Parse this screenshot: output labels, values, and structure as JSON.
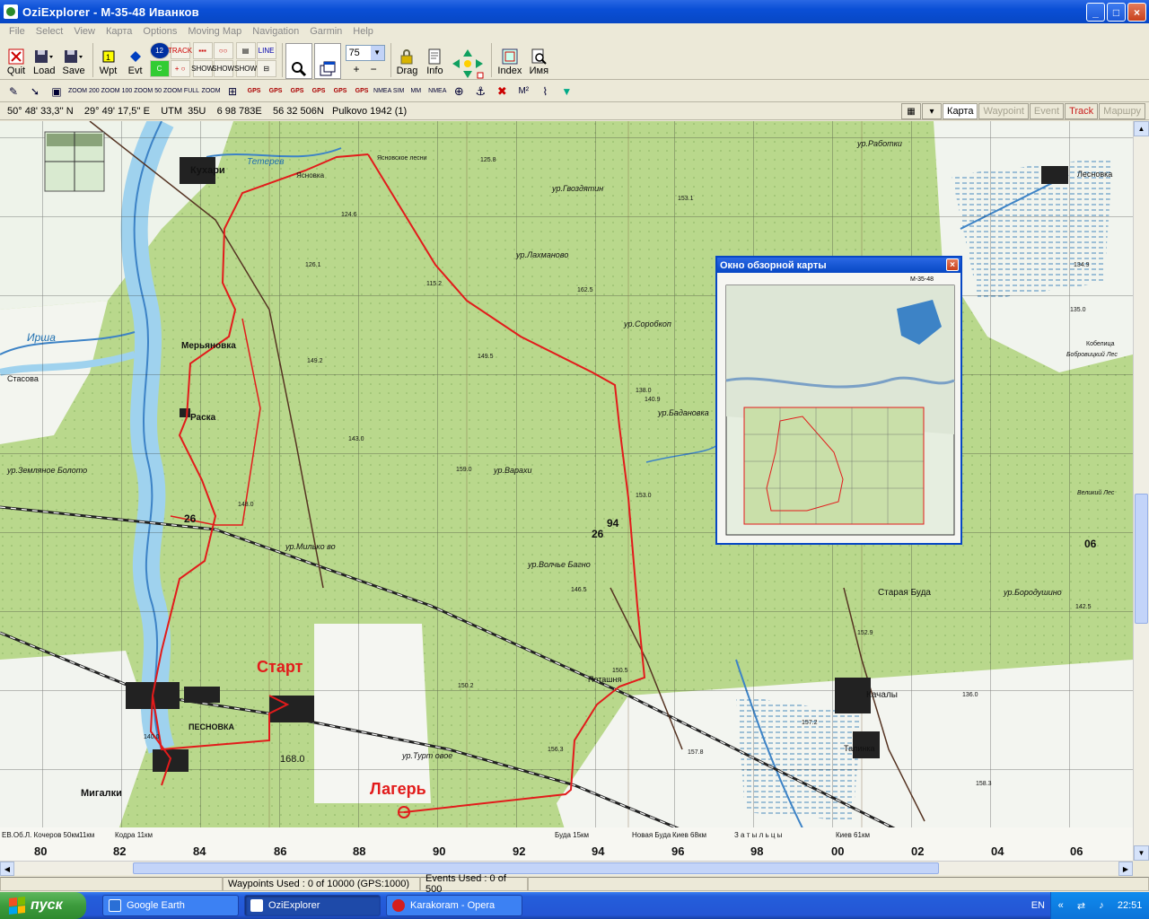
{
  "window": {
    "title": "OziExplorer - M-35-48 Иванков",
    "buttons": {
      "minimize": "_",
      "maximize": "□",
      "close": "×"
    }
  },
  "menu": [
    "File",
    "Select",
    "View",
    "Карта",
    "Options",
    "Moving Map",
    "Navigation",
    "Garmin",
    "Help"
  ],
  "toolbar1": {
    "quit": "Quit",
    "load": "Load",
    "save": "Save",
    "wpt": "Wpt",
    "evt": "Evt",
    "track_small": "TRACK",
    "show": "SHOW",
    "line": "LINE",
    "zoom_value": "75",
    "zoom_plus": "+",
    "zoom_minus": "−",
    "drag": "Drag",
    "info": "Info",
    "index": "Index",
    "name": "Имя"
  },
  "toolbar2": {
    "zoom200": "ZOOM 200",
    "zoom100": "ZOOM 100",
    "zoom50": "ZOOM 50",
    "zoomfull": "ZOOM FULL",
    "zoom": "ZOOM",
    "gps": [
      "GPS",
      "GPS",
      "GPS",
      "GPS",
      "GPS",
      "GPS"
    ],
    "nmea_sim": "NMEA SIM",
    "mm": "MM",
    "nmea": "NMEA"
  },
  "status": {
    "coords": "50° 48' 33,3'' N    29° 49' 17,5'' E    UTM  35U    6 98 783E    56 32 506N   Pulkovo 1942 (1)",
    "tabs": [
      "Карта",
      "Waypoint",
      "Event",
      "Track",
      "Маршру"
    ]
  },
  "map": {
    "labels": {
      "start": "Старт",
      "camp": "Лагерь",
      "kukhari": "Кухари",
      "teterev": "Тетерев",
      "yasnovka": "Ясновка",
      "yasnovskoe": "Ясновское лесни",
      "gvozdyatin": "ур.Гвоздятин",
      "lakhmanovo": "ур.Лахманово",
      "sorobkop": "ур.Соробкоп",
      "rabotki": "ур.Работки",
      "lesnovka": "Лесновка",
      "irsha": "Ирша",
      "meryanovka": "Мерьяновка",
      "raska": "Раска",
      "stasova": "Стасова",
      "zemlyanoe": "ур.Земляное Болото",
      "varakhi": "ур.Варахи",
      "milkovo": "ур.Милько во",
      "volche": "ур.Волчье Багно",
      "badanovo": "ур.Бадановка",
      "staraya_buda": "Старая Буда",
      "borodushino": "ур.Бородушино",
      "potashnya": "Поташня",
      "pesnovka": "ПЕСНОВКА",
      "migalki": "Мигалки",
      "turtovoe": "ур.Турт овое",
      "kachaly": "Качалы",
      "talinka": "Талинка",
      "kobelitsa": "Кобелица",
      "bobrovitsky": "Бобровицкий Лес",
      "velikiy_les": "Великий Лес"
    },
    "heights": [
      "125.8",
      "153.1",
      "162.5",
      "124.6",
      "126.1",
      "115.2",
      "149.2",
      "149.5",
      "143.0",
      "148.0",
      "159.0",
      "153.0",
      "146.5",
      "150.5",
      "150.2",
      "168.0",
      "156.3",
      "140.0",
      "157.2",
      "158.3",
      "152.9",
      "142.5",
      "138.0",
      "134.9",
      "135.0",
      "136.0",
      "140.9",
      "157.8"
    ],
    "bottom_texts": [
      "ЕВ.Об.Л. Кочеров 50км",
      "11км",
      "Кодра 11км",
      "Буда 15км",
      "Новая Буда",
      "Киев 68км",
      "З а т ы л ь ц ы",
      "Киев 61км"
    ],
    "grid_x": [
      "80",
      "82",
      "84",
      "86",
      "88",
      "90",
      "92",
      "94",
      "96",
      "98",
      "00",
      "02",
      "04",
      "06"
    ],
    "grid_y": [
      "26",
      "94",
      "26",
      "06"
    ]
  },
  "overview": {
    "title": "Окно обзорной карты",
    "sheet": "М-35-48",
    "close": "×"
  },
  "bottom_status": {
    "waypoints": "Waypoints Used : 0 of 10000  (GPS:1000)",
    "events": "Events Used : 0 of 500"
  },
  "taskbar": {
    "start": "пуск",
    "tasks": [
      "Google Earth",
      "OziExplorer",
      "Karakoram - Opera"
    ],
    "lang": "EN",
    "clock": "22:51"
  },
  "colors": {
    "xp_blue": "#0747c4",
    "route_red": "#e21b1b",
    "forest_green": "#b7d88a",
    "water_blue": "#bfe3f3"
  }
}
